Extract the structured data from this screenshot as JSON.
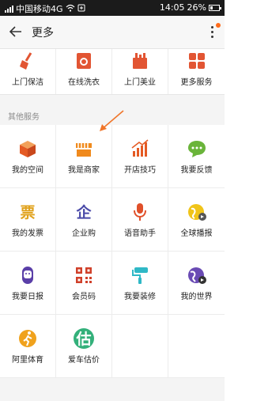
{
  "status_bar": {
    "carrier": "中国移动4G",
    "time": "14:05",
    "battery": "26%",
    "battery_level": 0.26
  },
  "header": {
    "title": "更多"
  },
  "top_services": [
    {
      "label": "上门保洁",
      "icon": "broom-icon",
      "color": "#e25533"
    },
    {
      "label": "在线洗衣",
      "icon": "washing-icon",
      "color": "#e25533"
    },
    {
      "label": "上门美业",
      "icon": "beauty-kit-icon",
      "color": "#e25533"
    },
    {
      "label": "更多服务",
      "icon": "more-services-icon",
      "color": "#e25533"
    }
  ],
  "section": {
    "label": "其他服务"
  },
  "services": [
    {
      "label": "我的空间",
      "icon": "space-box-icon",
      "color": "#e45a23"
    },
    {
      "label": "我是商家",
      "icon": "merchant-shop-icon",
      "color": "#f08a1d"
    },
    {
      "label": "开店技巧",
      "icon": "growth-chart-icon",
      "color": "#e45a23"
    },
    {
      "label": "我要反馈",
      "icon": "feedback-bubble-icon",
      "color": "#6ab43a"
    },
    {
      "label": "我的发票",
      "icon": "invoice-icon",
      "color": "#e0a21c",
      "glyph": "票"
    },
    {
      "label": "企业购",
      "icon": "enterprise-purchase-icon",
      "color": "#4a4aa8",
      "glyph": "企"
    },
    {
      "label": "语音助手",
      "icon": "microphone-icon",
      "color": "#e0502a"
    },
    {
      "label": "全球播报",
      "icon": "global-broadcast-icon",
      "color": "#f0c419"
    },
    {
      "label": "我要日报",
      "icon": "daily-report-icon",
      "color": "#5a3fa8"
    },
    {
      "label": "会员码",
      "icon": "qr-code-icon",
      "color": "#d0402a"
    },
    {
      "label": "我要装修",
      "icon": "paint-roller-icon",
      "color": "#2fb8c6"
    },
    {
      "label": "我的世界",
      "icon": "globe-icon",
      "color": "#6a4bb4"
    },
    {
      "label": "阿里体育",
      "icon": "sports-runner-icon",
      "color": "#f0a21d"
    },
    {
      "label": "爱车估价",
      "icon": "car-valuation-icon",
      "color": "#33b07a",
      "glyph": "估"
    }
  ],
  "annotation": {
    "color": "#f0762a"
  }
}
